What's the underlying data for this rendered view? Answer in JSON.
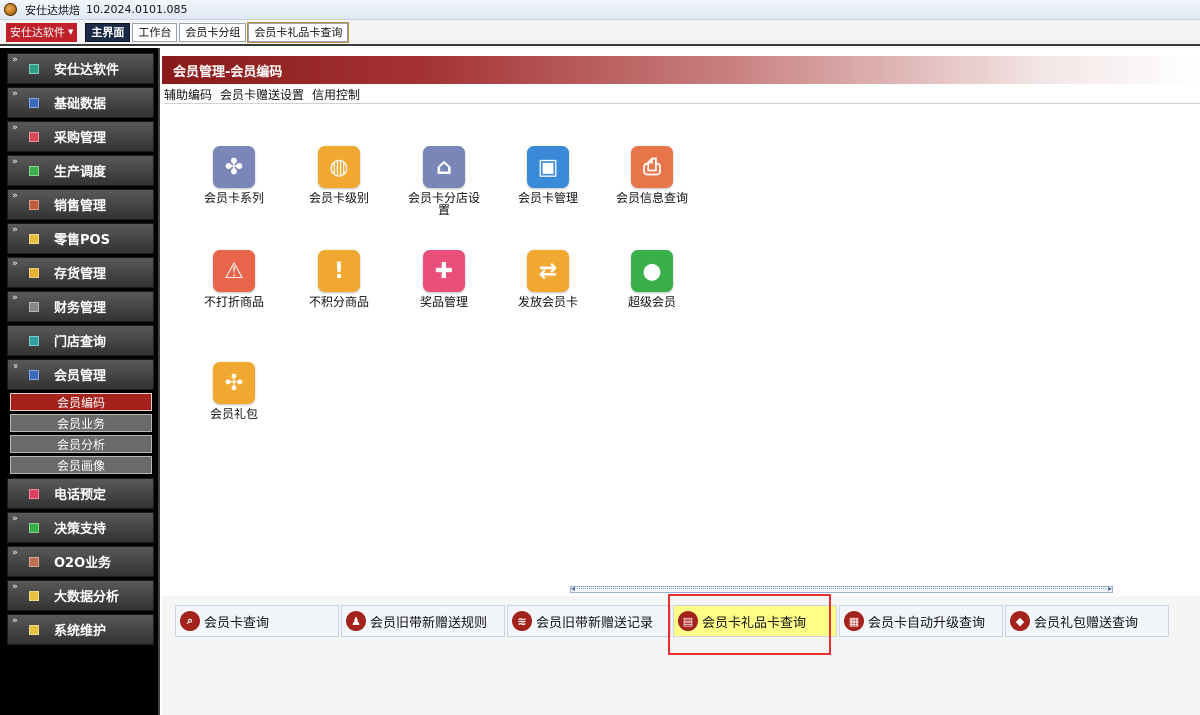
{
  "window": {
    "title": "安仕达烘焙",
    "version": "10.2024.0101.085"
  },
  "toolbar": {
    "brand_label": "安仕达软件",
    "tabs": [
      {
        "label": "主界面",
        "active": true
      },
      {
        "label": "工作台",
        "active": false
      },
      {
        "label": "会员卡分组",
        "active": false
      },
      {
        "label": "会员卡礼品卡查询",
        "active": false
      }
    ]
  },
  "sidebar": {
    "items": [
      {
        "label": "安仕达软件",
        "icon_color": "#2fa08a"
      },
      {
        "label": "基础数据",
        "icon_color": "#3a6ac0"
      },
      {
        "label": "采购管理",
        "icon_color": "#d84a5a"
      },
      {
        "label": "生产调度",
        "icon_color": "#3ab04a"
      },
      {
        "label": "销售管理",
        "icon_color": "#c05a3a"
      },
      {
        "label": "零售POS",
        "icon_color": "#e8c040"
      },
      {
        "label": "存货管理",
        "icon_color": "#e8b030"
      },
      {
        "label": "财务管理",
        "icon_color": "#888888"
      },
      {
        "label": "门店查询",
        "icon_color": "#2fa0a0"
      },
      {
        "label": "会员管理",
        "icon_color": "#3a6ac0"
      }
    ],
    "sub_items": [
      {
        "label": "会员编码",
        "active": true
      },
      {
        "label": "会员业务",
        "active": false
      },
      {
        "label": "会员分析",
        "active": false
      },
      {
        "label": "会员画像",
        "active": false
      }
    ],
    "items_after": [
      {
        "label": "电话预定",
        "icon_color": "#e04060"
      },
      {
        "label": "决策支持",
        "icon_color": "#3ab04a"
      },
      {
        "label": "O2O业务",
        "icon_color": "#c07050"
      },
      {
        "label": "大数据分析",
        "icon_color": "#e8c040"
      },
      {
        "label": "系统维护",
        "icon_color": "#e8c040"
      }
    ]
  },
  "main": {
    "header_title": "会员管理-会员编码",
    "subnav": [
      "辅助编码",
      "会员卡赠送设置",
      "信用控制"
    ],
    "functions": [
      {
        "label": "会员卡系列",
        "color": "#7a86b8",
        "icon": "grid-icon",
        "glyph": "✤"
      },
      {
        "label": "会员卡级别",
        "color": "#f0a830",
        "icon": "coins-icon",
        "glyph": "◍"
      },
      {
        "label": "会员卡分店设置",
        "color": "#7a86b8",
        "icon": "house-icon",
        "glyph": "⌂"
      },
      {
        "label": "会员卡管理",
        "color": "#3a8ad8",
        "icon": "card-manage-icon",
        "glyph": "▣"
      },
      {
        "label": "会员信息查询",
        "color": "#e8744a",
        "icon": "doc-search-icon",
        "glyph": "⎙"
      },
      {
        "label": "不打折商品",
        "color": "#e8644a",
        "icon": "warning-icon",
        "glyph": "⚠"
      },
      {
        "label": "不积分商品",
        "color": "#f0a830",
        "icon": "alert-icon",
        "glyph": "!"
      },
      {
        "label": "奖品管理",
        "color": "#e8507a",
        "icon": "gift-icon",
        "glyph": "✚"
      },
      {
        "label": "发放会员卡",
        "color": "#f0a830",
        "icon": "exchange-icon",
        "glyph": "⇄"
      },
      {
        "label": "超级会员",
        "color": "#3ab04a",
        "icon": "user-icon",
        "glyph": "●"
      },
      {
        "label": "会员礼包",
        "color": "#f0a830",
        "icon": "puzzle-icon",
        "glyph": "✣"
      }
    ],
    "shortcuts": [
      {
        "label": "会员卡查询",
        "color": "#a3221c",
        "icon": "search-icon",
        "glyph": "⌕",
        "active": false
      },
      {
        "label": "会员旧带新赠送规则",
        "color": "#a3221c",
        "icon": "person-icon",
        "glyph": "♟",
        "active": false
      },
      {
        "label": "会员旧带新赠送记录",
        "color": "#a3221c",
        "icon": "layers-icon",
        "glyph": "≋",
        "active": false
      },
      {
        "label": "会员卡礼品卡查询",
        "color": "#a3221c",
        "icon": "card-icon",
        "glyph": "▤",
        "active": true
      },
      {
        "label": "会员卡自动升级查询",
        "color": "#a3221c",
        "icon": "image-icon",
        "glyph": "▦",
        "active": false
      },
      {
        "label": "会员礼包赠送查询",
        "color": "#a3221c",
        "icon": "tag-icon",
        "glyph": "◆",
        "active": false
      }
    ]
  }
}
